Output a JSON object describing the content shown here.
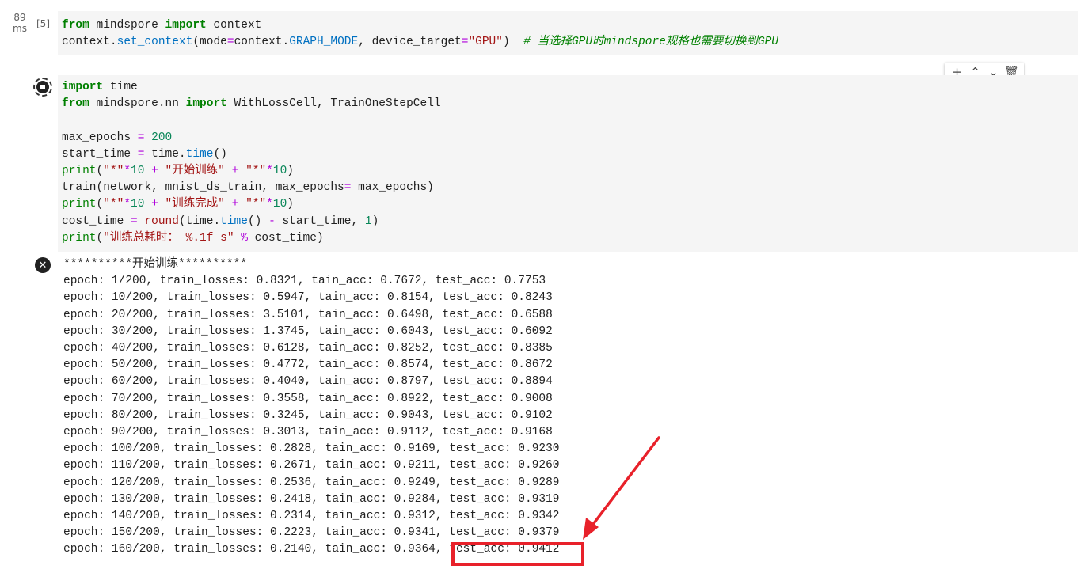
{
  "cell1": {
    "exec_time_value": "89",
    "exec_time_unit": "ms",
    "exec_count": "[5]",
    "code": {
      "l1_kw1": "from",
      "l1_mod": "mindspore",
      "l1_kw2": "import",
      "l1_name": "context",
      "l2_obj": "context.",
      "l2_fn": "set_context",
      "l2_p1": "(mode",
      "l2_eq1": "=",
      "l2_p2": "context.",
      "l2_const": "GRAPH_MODE",
      "l2_p3": ", device_target",
      "l2_eq2": "=",
      "l2_str": "\"GPU\"",
      "l2_p4": ")  ",
      "l2_cmt": "# 当选择GPU时mindspore规格也需要切换到GPU"
    }
  },
  "toolbar": {
    "add_icon": "+",
    "up_icon": "⌃",
    "down_icon": "⌄",
    "delete_icon": "🗑"
  },
  "cell2": {
    "code": {
      "l1_kw": "import",
      "l1_name": " time",
      "l2_kw1": "from",
      "l2_mod": " mindspore.nn ",
      "l2_kw2": "import",
      "l2_names": " WithLossCell, TrainOneStepCell",
      "l4_var": "max_epochs ",
      "l4_eq": "=",
      "l4_num": " 200",
      "l5_var": "start_time ",
      "l5_eq": "=",
      "l5_rest": " time.",
      "l5_fn": "time",
      "l5_end": "()",
      "l6_fn": "print",
      "l6_a": "(",
      "l6_s1": "\"*\"",
      "l6_op1": "*",
      "l6_n1": "10",
      "l6_op2": " + ",
      "l6_s2": "\"开始训练\"",
      "l6_op3": " + ",
      "l6_s3": "\"*\"",
      "l6_op4": "*",
      "l6_n2": "10",
      "l6_b": ")",
      "l7_text": "train(network, mnist_ds_train, max_epochs",
      "l7_eq": "=",
      "l7_end": " max_epochs)",
      "l8_fn": "print",
      "l8_a": "(",
      "l8_s1": "\"*\"",
      "l8_op1": "*",
      "l8_n1": "10",
      "l8_op2": " + ",
      "l8_s2": "\"训练完成\"",
      "l8_op3": " + ",
      "l8_s3": "\"*\"",
      "l8_op4": "*",
      "l8_n2": "10",
      "l8_b": ")",
      "l9_var": "cost_time ",
      "l9_eq": "=",
      "l9_sp": " ",
      "l9_fn1": "round",
      "l9_a": "(time.",
      "l9_fn2": "time",
      "l9_b": "() ",
      "l9_op": "-",
      "l9_c": " start_time, ",
      "l9_num": "1",
      "l9_d": ")",
      "l10_fn": "print",
      "l10_a": "(",
      "l10_str": "\"训练总耗时： %.1f s\"",
      "l10_sp": " ",
      "l10_op": "%",
      "l10_end": " cost_time)"
    }
  },
  "output": {
    "header": "**********开始训练**********",
    "lines": [
      "epoch: 1/200, train_losses: 0.8321, tain_acc: 0.7672, test_acc: 0.7753",
      "epoch: 10/200, train_losses: 0.5947, tain_acc: 0.8154, test_acc: 0.8243",
      "epoch: 20/200, train_losses: 3.5101, tain_acc: 0.6498, test_acc: 0.6588",
      "epoch: 30/200, train_losses: 1.3745, tain_acc: 0.6043, test_acc: 0.6092",
      "epoch: 40/200, train_losses: 0.6128, tain_acc: 0.8252, test_acc: 0.8385",
      "epoch: 50/200, train_losses: 0.4772, tain_acc: 0.8574, test_acc: 0.8672",
      "epoch: 60/200, train_losses: 0.4040, tain_acc: 0.8797, test_acc: 0.8894",
      "epoch: 70/200, train_losses: 0.3558, tain_acc: 0.8922, test_acc: 0.9008",
      "epoch: 80/200, train_losses: 0.3245, tain_acc: 0.9043, test_acc: 0.9102",
      "epoch: 90/200, train_losses: 0.3013, tain_acc: 0.9112, test_acc: 0.9168",
      "epoch: 100/200, train_losses: 0.2828, tain_acc: 0.9169, test_acc: 0.9230",
      "epoch: 110/200, train_losses: 0.2671, tain_acc: 0.9211, test_acc: 0.9260",
      "epoch: 120/200, train_losses: 0.2536, tain_acc: 0.9249, test_acc: 0.9289",
      "epoch: 130/200, train_losses: 0.2418, tain_acc: 0.9284, test_acc: 0.9319",
      "epoch: 140/200, train_losses: 0.2314, tain_acc: 0.9312, test_acc: 0.9342",
      "epoch: 150/200, train_losses: 0.2223, tain_acc: 0.9341, test_acc: 0.9379",
      "epoch: 160/200, train_losses: 0.2140, tain_acc: 0.9364, test_acc: 0.9412"
    ]
  },
  "annotation": {
    "color": "#e8212a"
  }
}
